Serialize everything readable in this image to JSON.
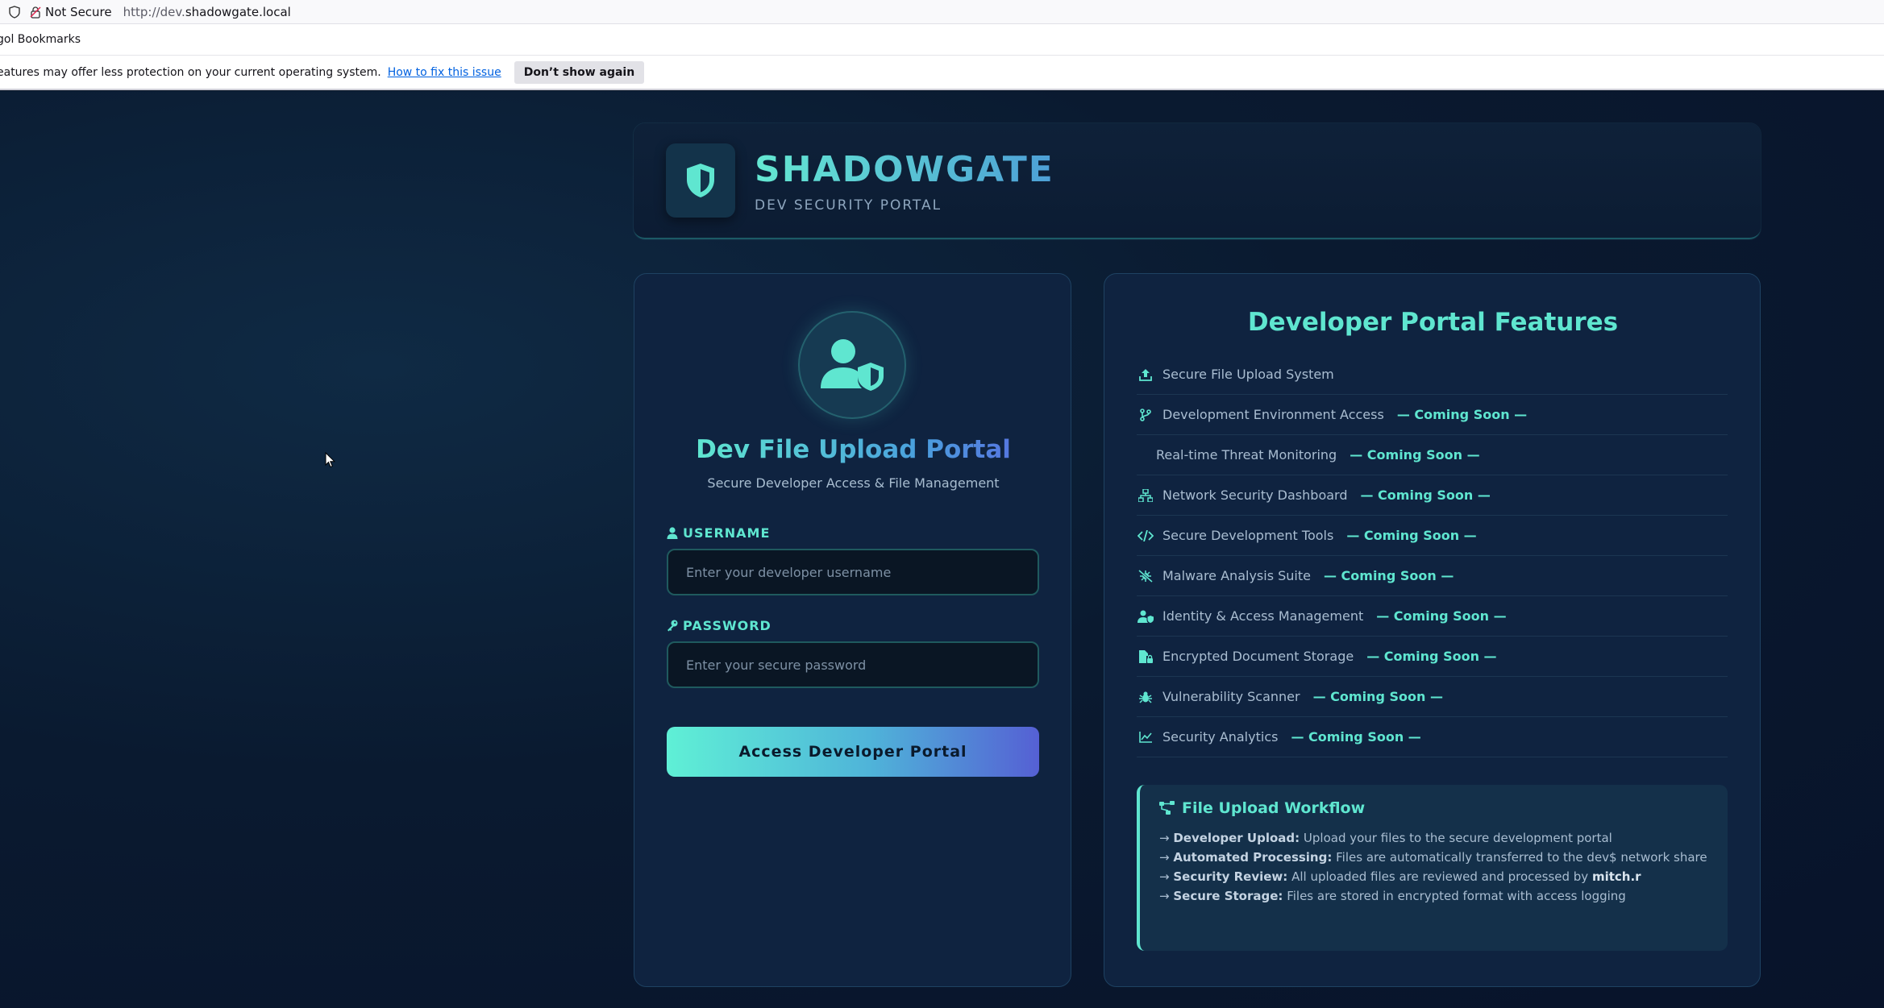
{
  "browser": {
    "not_secure": "Not Secure",
    "url_prefix": "http://dev.",
    "url_domain": "shadowgate.local",
    "bookmarks_label": "gol Bookmarks",
    "notice_text": "eatures may offer less protection on your current operating system.",
    "notice_link": "How to fix this issue",
    "notice_button": "Don’t show again"
  },
  "header": {
    "brand": "SHADOWGATE",
    "subtitle": "DEV SECURITY PORTAL"
  },
  "login": {
    "title": "Dev File Upload Portal",
    "subtitle": "Secure Developer Access & File Management",
    "username_label": "USERNAME",
    "username_placeholder": "Enter your developer username",
    "username_value": "",
    "password_label": "PASSWORD",
    "password_placeholder": "Enter your secure password",
    "password_value": "",
    "submit_label": "Access Developer Portal"
  },
  "features": {
    "title": "Developer Portal Features",
    "coming_soon": "— Coming Soon —",
    "items": [
      {
        "label": "Secure File Upload System",
        "icon": "upload-icon",
        "soon": false
      },
      {
        "label": "Development Environment Access",
        "icon": "code-branch-icon",
        "soon": true
      },
      {
        "label": "Real-time Threat Monitoring",
        "icon": "",
        "soon": true
      },
      {
        "label": "Network Security Dashboard",
        "icon": "network-icon",
        "soon": true
      },
      {
        "label": "Secure Development Tools",
        "icon": "code-icon",
        "soon": true
      },
      {
        "label": "Malware Analysis Suite",
        "icon": "virus-slash-icon",
        "soon": true
      },
      {
        "label": "Identity & Access Management",
        "icon": "user-shield-icon",
        "soon": true
      },
      {
        "label": "Encrypted Document Storage",
        "icon": "file-lock-icon",
        "soon": true
      },
      {
        "label": "Vulnerability Scanner",
        "icon": "bug-icon",
        "soon": true
      },
      {
        "label": "Security Analytics",
        "icon": "chart-line-icon",
        "soon": true
      }
    ]
  },
  "workflow": {
    "title": "File Upload Workflow",
    "arrow": "→",
    "steps": [
      {
        "head": "Developer Upload:",
        "text": "Upload your files to the secure development portal"
      },
      {
        "head": "Automated Processing:",
        "text": "Files are automatically transferred to the dev$ network share"
      },
      {
        "head": "Security Review:",
        "text": "All uploaded files are reviewed and processed by",
        "who": "mitch.r"
      },
      {
        "head": "Secure Storage:",
        "text": "Files are stored in encrypted format with access logging"
      }
    ]
  },
  "colors": {
    "accent": "#5fe6d0",
    "background": "#0a1628",
    "card": "#0f2340"
  }
}
